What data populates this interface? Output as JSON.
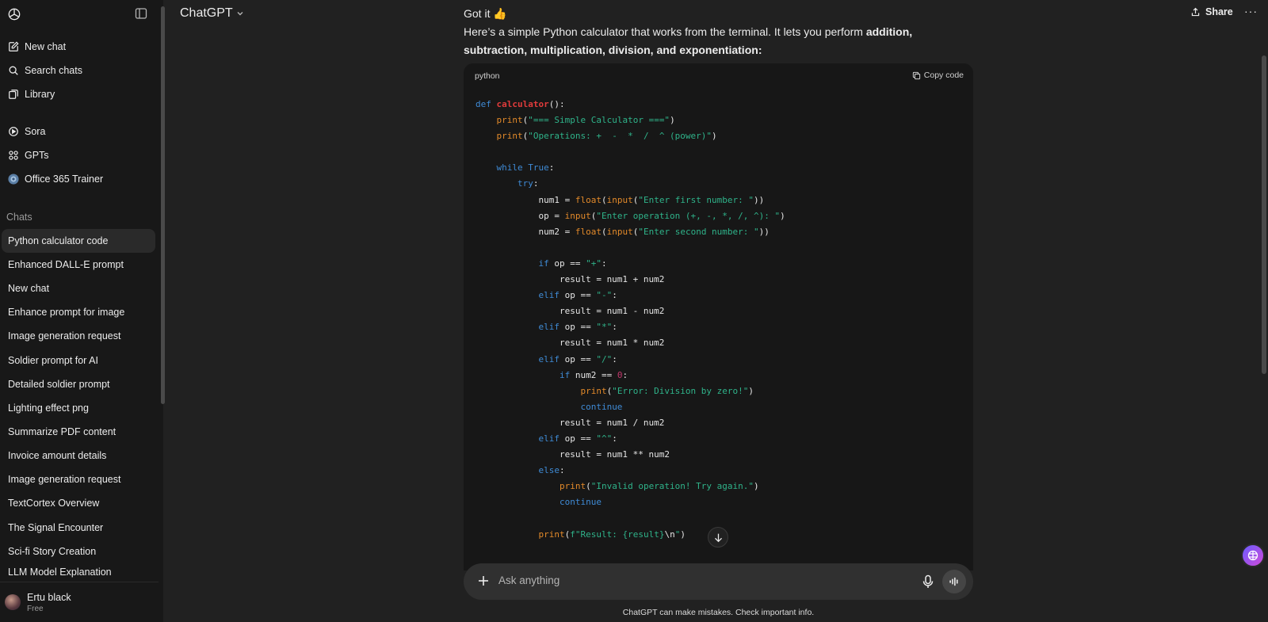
{
  "sidebar": {
    "primary": [
      {
        "label": "New chat",
        "icon": "edit-icon"
      },
      {
        "label": "Search chats",
        "icon": "search-icon"
      },
      {
        "label": "Library",
        "icon": "library-icon"
      }
    ],
    "secondary": [
      {
        "label": "Sora",
        "icon": "play-circle-icon"
      },
      {
        "label": "GPTs",
        "icon": "grid-icon"
      },
      {
        "label": "Office 365 Trainer",
        "icon": "gpt-avatar-icon"
      }
    ],
    "chats_heading": "Chats",
    "chats": [
      "Python calculator code",
      "Enhanced DALL-E prompt",
      "New chat",
      "Enhance prompt for image",
      "Image generation request",
      "Soldier prompt for AI",
      "Detailed soldier prompt",
      "Lighting effect png",
      "Summarize PDF content",
      "Invoice amount details",
      "Image generation request",
      "TextCortex Overview",
      "The Signal Encounter",
      "Sci-fi Story Creation",
      "LLM Model Explanation"
    ],
    "active_chat_index": 0,
    "user": {
      "name": "Ertu black",
      "plan": "Free"
    }
  },
  "header": {
    "model": "ChatGPT",
    "share_label": "Share",
    "more_label": "···"
  },
  "message": {
    "line1": "Got it 👍",
    "intro": "Here’s a simple Python calculator that works from the terminal. It lets you perform ",
    "bold": "addition, subtraction, multiplication, division, and exponentiation",
    "end": ":"
  },
  "code_block": {
    "language": "python",
    "copy_label": "Copy code"
  },
  "composer": {
    "placeholder": "Ask anything"
  },
  "disclaimer": "ChatGPT can make mistakes. Check important info.",
  "colors": {
    "background": "#212121",
    "sidebar": "#181818",
    "code_bg": "#171717",
    "keyword": "#3f8bd6",
    "function": "#e03b3b",
    "builtin": "#e38a2a",
    "string": "#2fb38a",
    "number": "#c3376b"
  }
}
